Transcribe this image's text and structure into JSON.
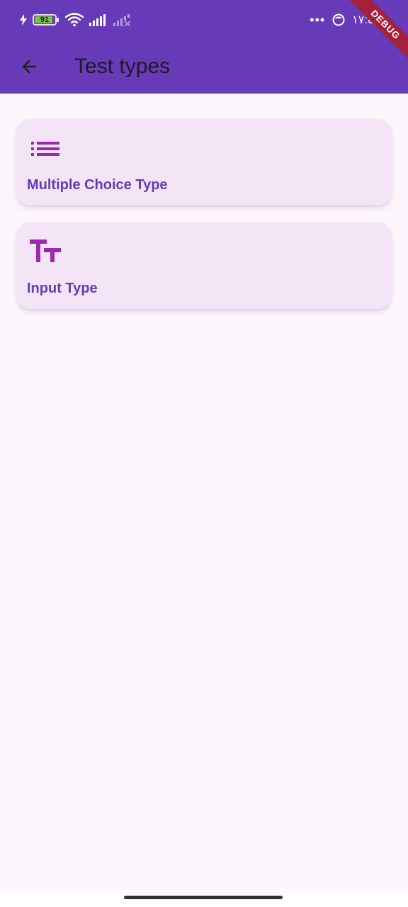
{
  "status_bar": {
    "battery_percent": "91",
    "time": "١٧:٤٧",
    "icons": [
      "charging-bolt-icon",
      "battery-icon",
      "wifi-icon",
      "signal-icon",
      "signal-no-service-icon",
      "more-dots-icon",
      "face-icon"
    ]
  },
  "debug_banner": "DEBUG",
  "app_bar": {
    "title": "Test types",
    "back_icon": "arrow-back-icon"
  },
  "cards": [
    {
      "label": "Multiple Choice Type",
      "icon": "format-list-bulleted-icon"
    },
    {
      "label": "Input Type",
      "icon": "text-fields-icon"
    }
  ],
  "colors": {
    "primary": "#673ab7",
    "card_background": "#f3e5f5",
    "icon_color": "#9c27b0",
    "page_background": "#fdf6fd"
  }
}
